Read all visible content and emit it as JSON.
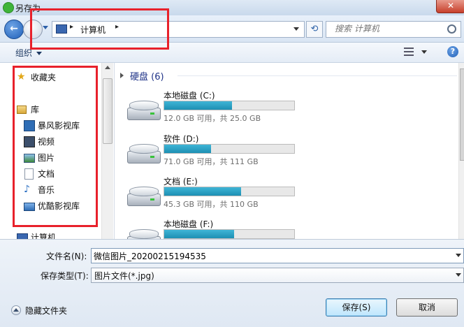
{
  "window": {
    "title": "另存为",
    "close_glyph": "✕"
  },
  "nav": {
    "back_glyph": "←",
    "breadcrumb": [
      "计算机"
    ],
    "separator": "▸",
    "refresh_glyph": "⟲",
    "search_placeholder": "搜索 计算机"
  },
  "toolbar": {
    "organize_label": "组织",
    "help_glyph": "?"
  },
  "sidebar": {
    "items": [
      {
        "label": "收藏夹",
        "icon": "star-icon"
      },
      {
        "label": "库",
        "icon": "library-icon"
      },
      {
        "label": "暴风影视库",
        "icon": "video-library-icon"
      },
      {
        "label": "视频",
        "icon": "video-icon"
      },
      {
        "label": "图片",
        "icon": "picture-icon"
      },
      {
        "label": "文档",
        "icon": "document-icon"
      },
      {
        "label": "音乐",
        "icon": "music-icon"
      },
      {
        "label": "优酷影视库",
        "icon": "folder-icon"
      },
      {
        "label": "计算机",
        "icon": "computer-icon"
      }
    ]
  },
  "content": {
    "group_title": "硬盘 (6)",
    "drives": [
      {
        "name": "本地磁盘 (C:)",
        "info": "12.0 GB 可用，共 25.0 GB",
        "used_fraction": 0.52
      },
      {
        "name": "软件 (D:)",
        "info": "71.0 GB 可用，共 111 GB",
        "used_fraction": 0.36
      },
      {
        "name": "文档 (E:)",
        "info": "45.3 GB 可用，共 110 GB",
        "used_fraction": 0.59
      },
      {
        "name": "本地磁盘 (F:)",
        "info": "",
        "used_fraction": 0.54
      }
    ]
  },
  "form": {
    "filename_label": "文件名(N):",
    "filename_value": "微信图片_20200215194535",
    "filetype_label": "保存类型(T):",
    "filetype_value": "图片文件(*.jpg)",
    "hide_folders_label": "隐藏文件夹",
    "save_label": "保存(S)",
    "cancel_label": "取消"
  },
  "colors": {
    "annotation_red": "#e8212b",
    "drive_bar": "#1d8fb3",
    "accent_blue": "#1f5fb8"
  }
}
